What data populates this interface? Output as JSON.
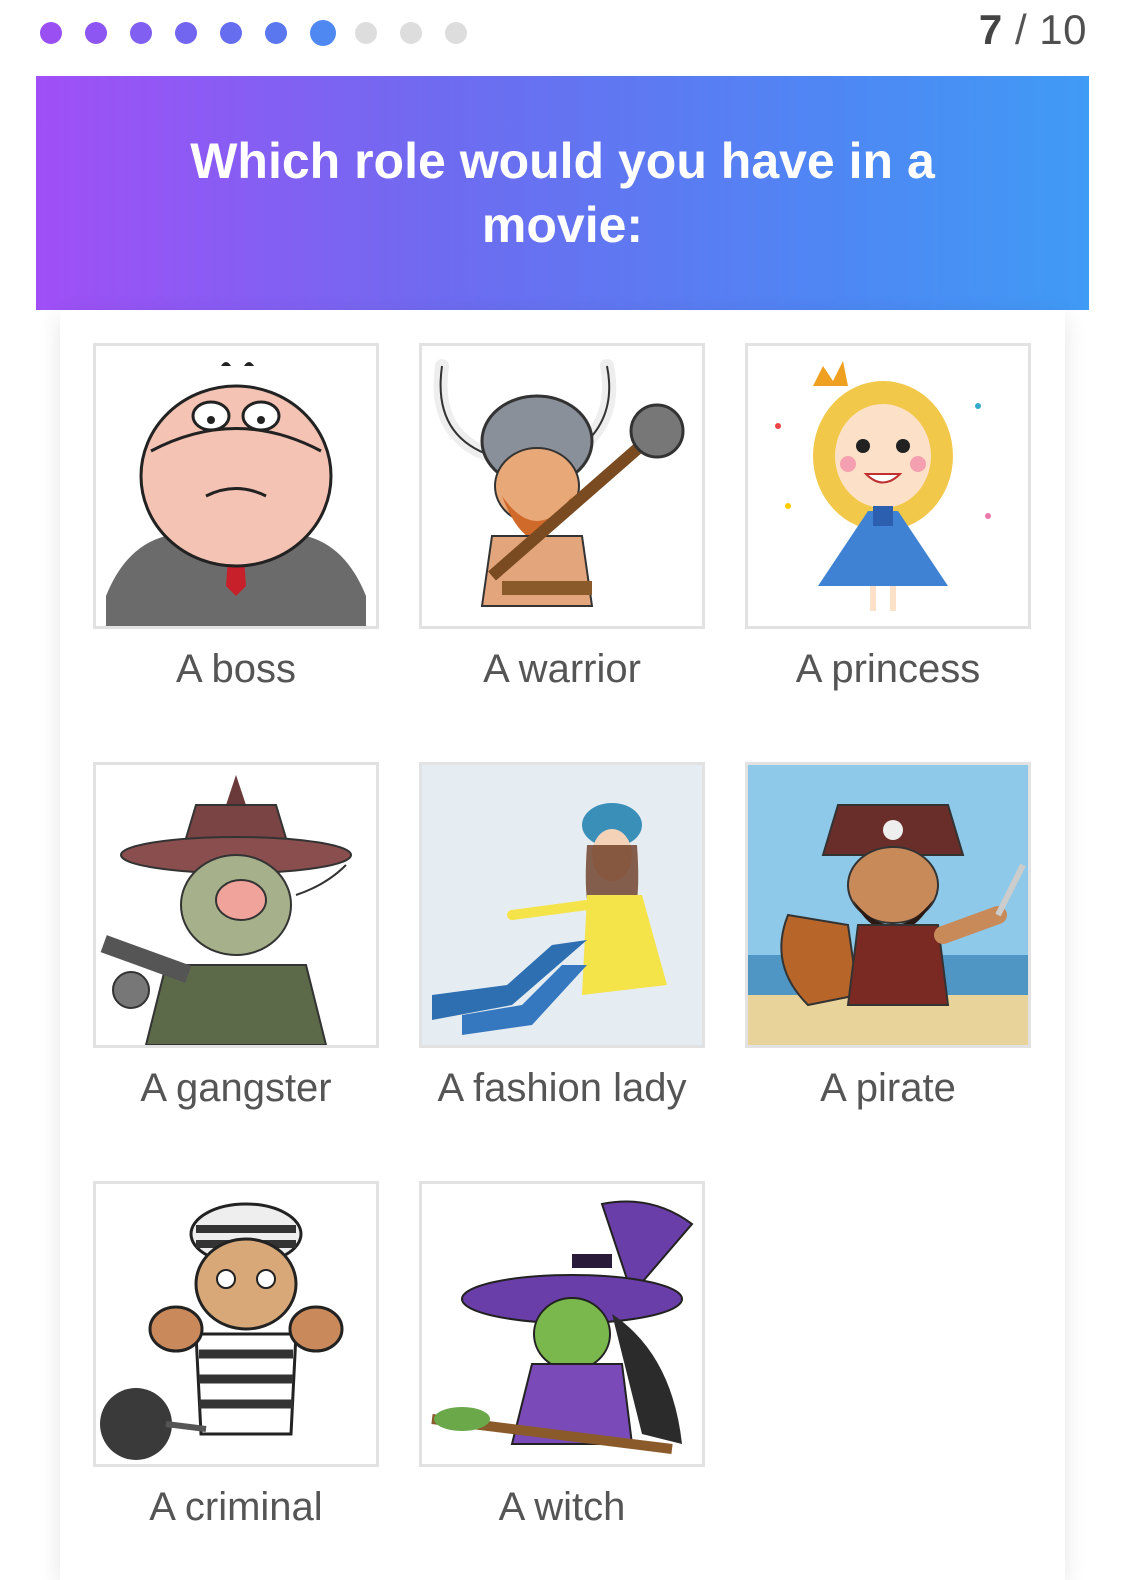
{
  "progress": {
    "current": 7,
    "total": 10,
    "separator": "/",
    "dot_colors": [
      "#9a4ff3",
      "#8d56f2",
      "#805ff1",
      "#7266f0",
      "#666def",
      "#5a77ef",
      "#4f88f0",
      "#dddddd",
      "#dddddd",
      "#dddddd"
    ]
  },
  "question": {
    "text": "Which role would you have in a movie:"
  },
  "options": [
    {
      "label": "A boss",
      "image": "boss-image"
    },
    {
      "label": "A warrior",
      "image": "warrior-image"
    },
    {
      "label": "A princess",
      "image": "princess-image"
    },
    {
      "label": "A gangster",
      "image": "gangster-image"
    },
    {
      "label": "A fashion lady",
      "image": "fashion-lady-image"
    },
    {
      "label": "A pirate",
      "image": "pirate-image"
    },
    {
      "label": "A criminal",
      "image": "criminal-image"
    },
    {
      "label": "A witch",
      "image": "witch-image"
    }
  ],
  "colors": {
    "banner_start": "#a04ff6",
    "banner_end": "#409bf5",
    "active_dot": "#4f88f0",
    "inactive_dot": "#dddddd"
  }
}
